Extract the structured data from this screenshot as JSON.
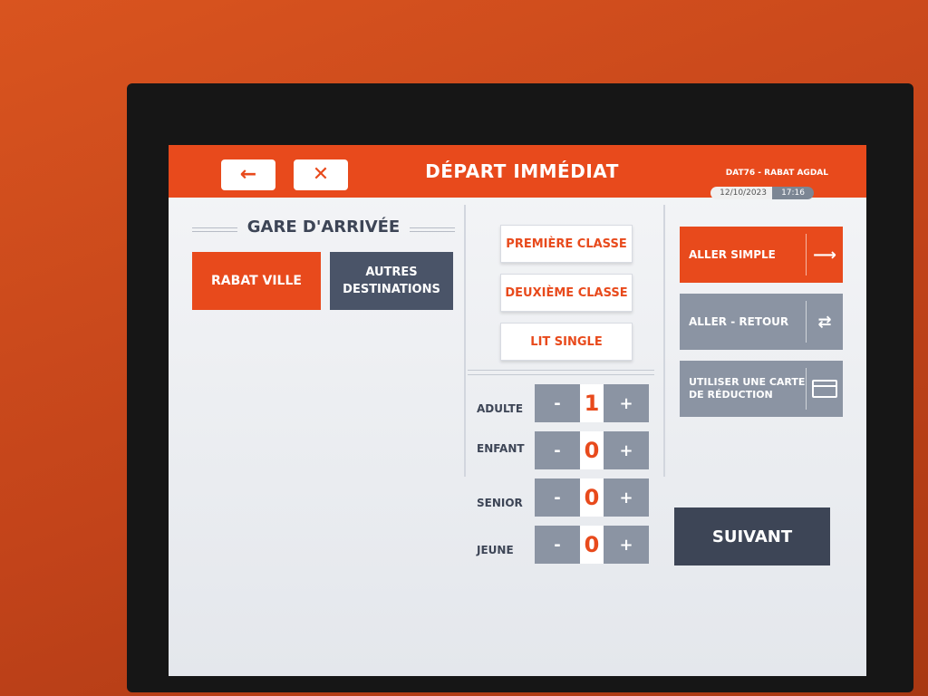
{
  "header": {
    "title": "DÉPART IMMÉDIAT",
    "back_icon": "←",
    "close_icon": "✕",
    "route": "DAT76 - RABAT AGDAL",
    "date": "12/10/2023",
    "time": "17:16"
  },
  "arrival": {
    "title": "GARE D'ARRIVÉE",
    "options": [
      "RABAT VILLE",
      "AUTRES DESTINATIONS"
    ]
  },
  "classes": [
    "PREMIÈRE CLASSE",
    "DEUXIÈME CLASSE",
    "LIT SINGLE"
  ],
  "passengers": [
    {
      "label": "ADULTE",
      "count": "1"
    },
    {
      "label": "ENFANT",
      "count": "0"
    },
    {
      "label": "SENIOR",
      "count": "0"
    },
    {
      "label": "JEUNE",
      "count": "0"
    }
  ],
  "stepper": {
    "minus": "-",
    "plus": "+"
  },
  "trip": {
    "one_way": "ALLER SIMPLE",
    "one_way_icon": "⟶",
    "round_trip": "ALLER - RETOUR",
    "round_trip_icon": "⇄",
    "discount_card_line1": "UTILISER UNE CARTE",
    "discount_card_line2": "DE RÉDUCTION"
  },
  "next_button": "SUIVANT",
  "colors": {
    "accent": "#e84a1c",
    "slate": "#4a5468",
    "gray_button": "#8b94a3",
    "dark_button": "#3d4556",
    "kiosk_body": "#c8461a"
  }
}
